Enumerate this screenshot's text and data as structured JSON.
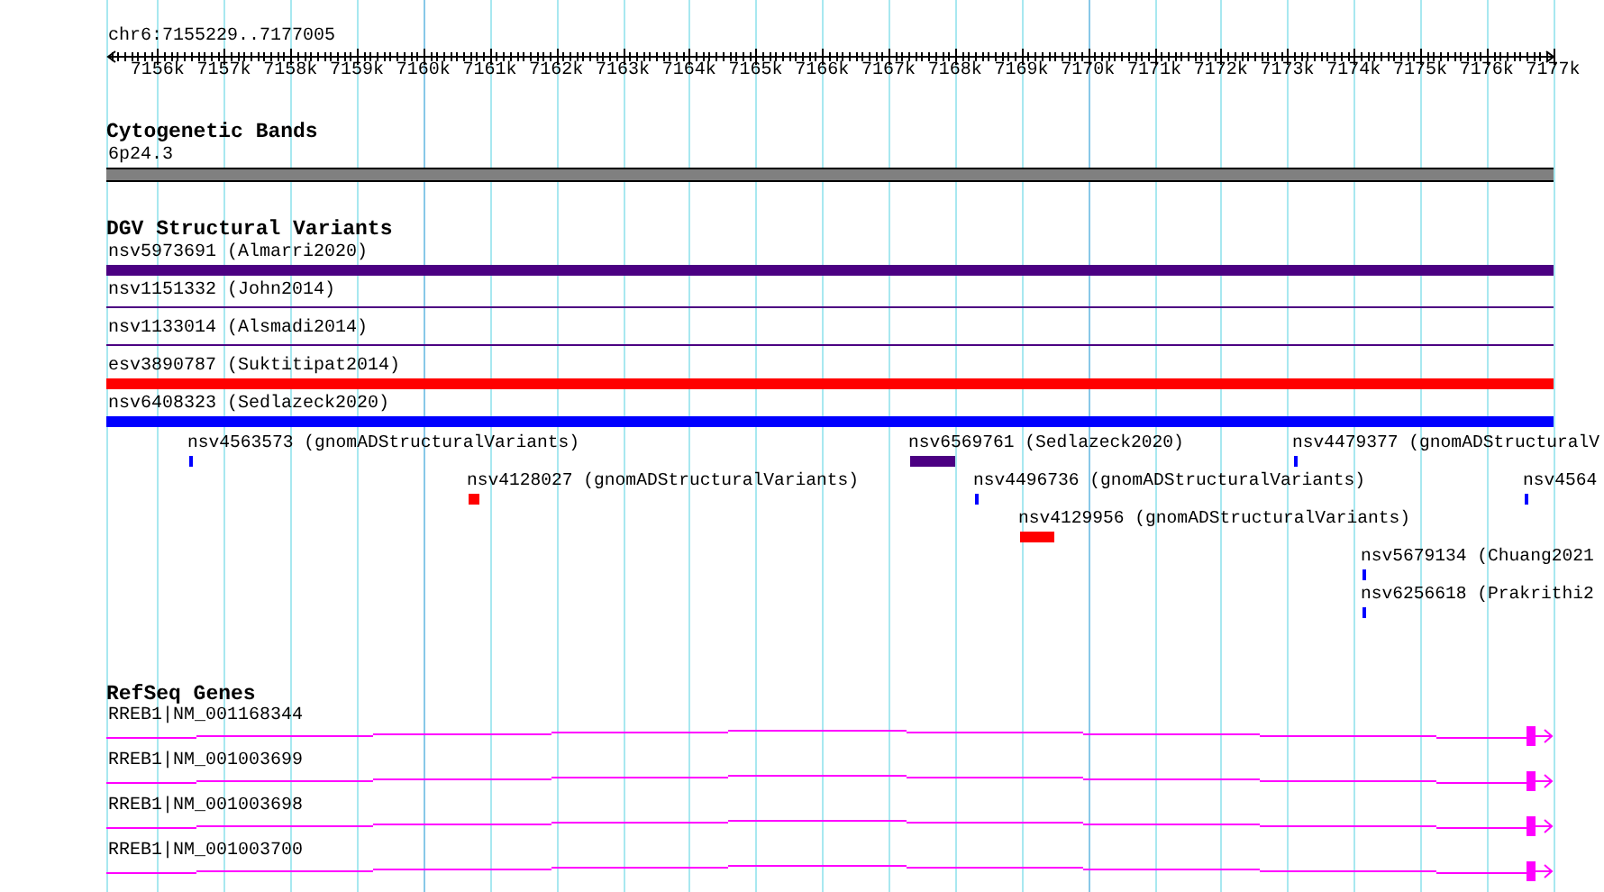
{
  "location": "chr6:7155229..7177005",
  "ruler": {
    "ticks": [
      "7156k",
      "7157k",
      "7158k",
      "7159k",
      "7160k",
      "7161k",
      "7162k",
      "7163k",
      "7164k",
      "7165k",
      "7166k",
      "7167k",
      "7168k",
      "7169k",
      "7170k",
      "7171k",
      "7172k",
      "7173k",
      "7174k",
      "7175k",
      "7176k",
      "7177k"
    ]
  },
  "cytoband_track": {
    "title": "Cytogenetic Bands",
    "band": "6p24.3"
  },
  "dgv_track": {
    "title": "DGV Structural Variants",
    "variants": [
      {
        "label": "nsv5973691 (Almarri2020)",
        "kind": "bar",
        "color": "#4b0082"
      },
      {
        "label": "nsv1151332 (John2014)",
        "kind": "line",
        "color": "#4b0082"
      },
      {
        "label": "nsv1133014 (Alsmadi2014)",
        "kind": "line",
        "color": "#4b0082"
      },
      {
        "label": "esv3890787 (Suktitipat2014)",
        "kind": "bar",
        "color": "#ff0000"
      },
      {
        "label": "nsv6408323 (Sedlazeck2020)",
        "kind": "bar",
        "color": "#0000ff"
      }
    ],
    "feature_rows": [
      {
        "features": [
          {
            "label": "nsv4563573 (gnomADStructuralVariants)",
            "color": "#0000ff"
          },
          {
            "label": "nsv6569761 (Sedlazeck2020)",
            "color": "#4b0082"
          },
          {
            "label": "nsv4479377 (gnomADStructuralV",
            "color": "#0000ff"
          }
        ]
      },
      {
        "features": [
          {
            "label": "nsv4128027 (gnomADStructuralVariants)",
            "color": "#ff0000"
          },
          {
            "label": "nsv4496736 (gnomADStructuralVariants)",
            "color": "#0000ff"
          },
          {
            "label": "nsv4564",
            "color": "#0000ff"
          }
        ]
      },
      {
        "features": [
          {
            "label": "nsv4129956 (gnomADStructuralVariants)",
            "color": "#ff0000"
          }
        ]
      },
      {
        "features": [
          {
            "label": "nsv5679134 (Chuang2021",
            "color": "#0000ff"
          }
        ]
      },
      {
        "features": [
          {
            "label": "nsv6256618 (Prakrithi2",
            "color": "#0000ff"
          }
        ]
      }
    ]
  },
  "refseq_track": {
    "title": "RefSeq Genes",
    "transcripts": [
      {
        "label": "RREB1|NM_001168344"
      },
      {
        "label": "RREB1|NM_001003699"
      },
      {
        "label": "RREB1|NM_001003698"
      },
      {
        "label": "RREB1|NM_001003700"
      }
    ]
  }
}
